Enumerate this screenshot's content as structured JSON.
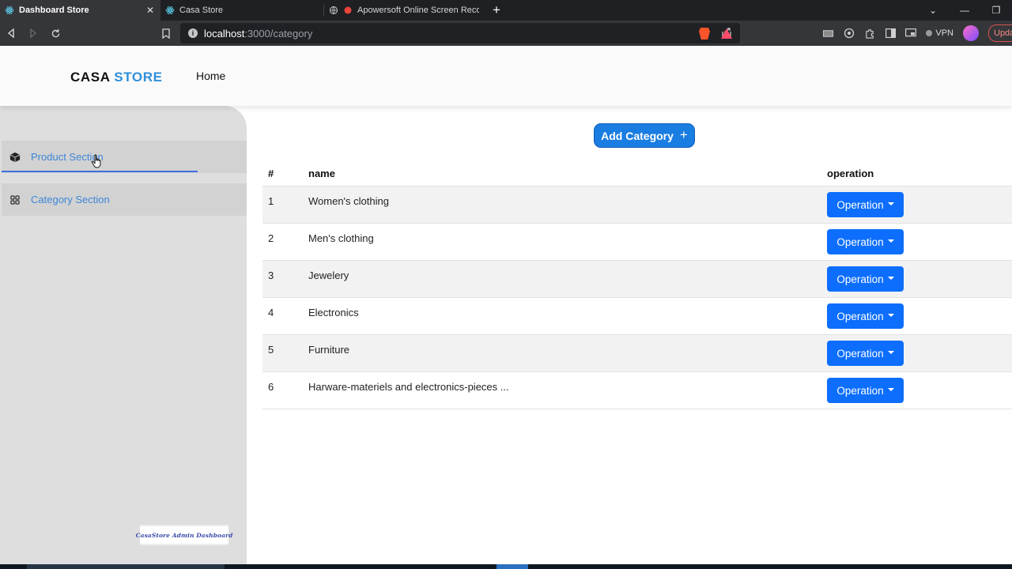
{
  "browser": {
    "tabs": [
      {
        "title": "Dashboard Store",
        "active": true
      },
      {
        "title": "Casa Store",
        "active": false
      },
      {
        "title": "Apowersoft Online Screen Recorde",
        "active": false
      }
    ],
    "close_symbol": "✕",
    "new_tab_symbol": "+",
    "url_host": "localhost",
    "url_path": ":3000/category",
    "vpn_label": "VPN",
    "update_label": "Upda"
  },
  "header": {
    "brand_part1": "CASA",
    "brand_part2": "STORE",
    "nav_home": "Home"
  },
  "sidebar": {
    "items": [
      {
        "label": "Product Section",
        "icon": "box-icon"
      },
      {
        "label": "Category Section",
        "icon": "grid-icon"
      }
    ],
    "footer_text": "CasaStore Admin Dashboard"
  },
  "main": {
    "add_button_label": "Add Category",
    "add_button_icon": "+",
    "table": {
      "headers": [
        "#",
        "name",
        "operation"
      ],
      "rows": [
        {
          "n": "1",
          "name": "Women's clothing",
          "op": "Operation"
        },
        {
          "n": "2",
          "name": "Men's clothing",
          "op": "Operation"
        },
        {
          "n": "3",
          "name": "Jewelery",
          "op": "Operation"
        },
        {
          "n": "4",
          "name": "Electronics",
          "op": "Operation"
        },
        {
          "n": "5",
          "name": "Furniture",
          "op": "Operation"
        },
        {
          "n": "6",
          "name": "Harware-materiels and electronics-pieces ...",
          "op": "Operation"
        }
      ]
    }
  },
  "colors": {
    "brand_blue": "#2f8fd8",
    "primary_button": "#0d6efd",
    "sidebar_bg": "#dedede",
    "sidebar_link": "#3d86d8"
  }
}
